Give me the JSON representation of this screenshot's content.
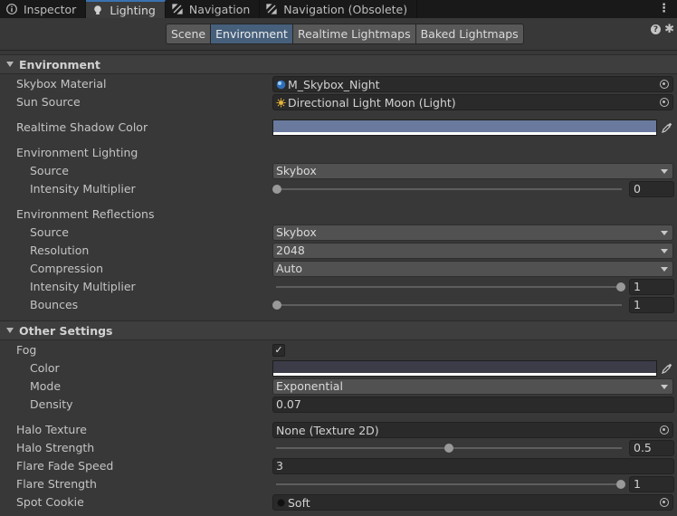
{
  "tabs": [
    {
      "label": "Inspector",
      "icon": "info-icon",
      "active": false
    },
    {
      "label": "Lighting",
      "icon": "lightbulb-icon",
      "active": true
    },
    {
      "label": "Navigation",
      "icon": "navigation-icon",
      "active": false
    },
    {
      "label": "Navigation (Obsolete)",
      "icon": "navigation-icon",
      "active": false
    }
  ],
  "toolbar": {
    "buttons": [
      "Scene",
      "Environment",
      "Realtime Lightmaps",
      "Baked Lightmaps"
    ],
    "selected": "Environment"
  },
  "environment": {
    "header": "Environment",
    "skybox_material": {
      "label": "Skybox Material",
      "value": "M_Skybox_Night"
    },
    "sun_source": {
      "label": "Sun Source",
      "value": "Directional Light Moon (Light)"
    },
    "shadow_color": {
      "label": "Realtime Shadow Color",
      "color": "#6a7a9e"
    },
    "lighting": {
      "label": "Environment Lighting",
      "source": {
        "label": "Source",
        "value": "Skybox"
      },
      "intensity": {
        "label": "Intensity Multiplier",
        "value": "0",
        "fraction": 0.0
      }
    },
    "reflections": {
      "label": "Environment Reflections",
      "source": {
        "label": "Source",
        "value": "Skybox"
      },
      "resolution": {
        "label": "Resolution",
        "value": "2048"
      },
      "compression": {
        "label": "Compression",
        "value": "Auto"
      },
      "intensity": {
        "label": "Intensity Multiplier",
        "value": "1",
        "fraction": 1.0
      },
      "bounces": {
        "label": "Bounces",
        "value": "1",
        "fraction": 0.0
      }
    }
  },
  "other": {
    "header": "Other Settings",
    "fog": {
      "label": "Fog",
      "checked": true,
      "check_glyph": "✓"
    },
    "fog_color": {
      "label": "Color",
      "color": "#3c3c48"
    },
    "fog_mode": {
      "label": "Mode",
      "value": "Exponential"
    },
    "fog_density": {
      "label": "Density",
      "value": "0.07"
    },
    "halo_texture": {
      "label": "Halo Texture",
      "value": "None (Texture 2D)"
    },
    "halo_strength": {
      "label": "Halo Strength",
      "value": "0.5",
      "fraction": 0.5
    },
    "flare_fade": {
      "label": "Flare Fade Speed",
      "value": "3"
    },
    "flare_strength": {
      "label": "Flare Strength",
      "value": "1",
      "fraction": 1.0
    },
    "spot_cookie": {
      "label": "Spot Cookie",
      "value": "Soft"
    }
  }
}
